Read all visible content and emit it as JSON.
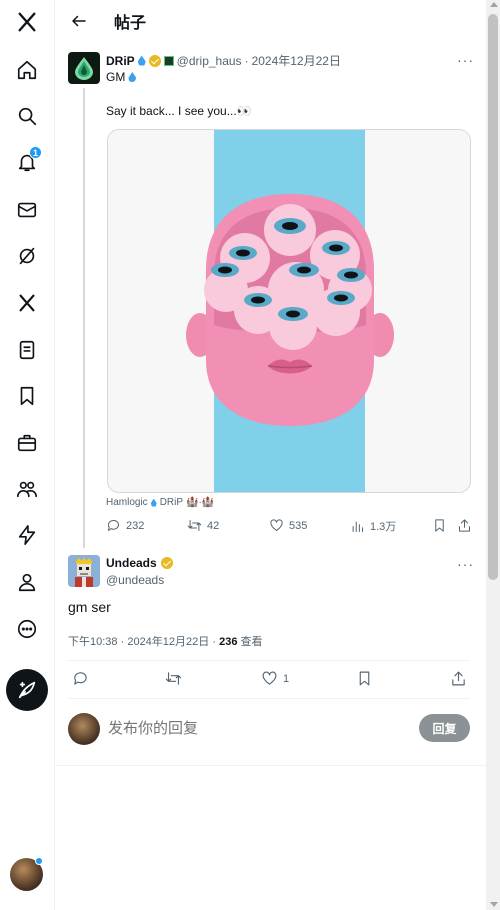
{
  "header": {
    "title": "帖子"
  },
  "sidebar": {
    "items": [
      {
        "icon": "x-logo-icon"
      },
      {
        "icon": "home-icon"
      },
      {
        "icon": "search-icon"
      },
      {
        "icon": "bell-icon",
        "badge": "1"
      },
      {
        "icon": "mail-icon"
      },
      {
        "icon": "grok-icon"
      },
      {
        "icon": "x-icon"
      },
      {
        "icon": "lists-icon"
      },
      {
        "icon": "bookmark-icon"
      },
      {
        "icon": "briefcase-icon"
      },
      {
        "icon": "communities-icon"
      },
      {
        "icon": "lightning-icon"
      },
      {
        "icon": "profile-icon"
      },
      {
        "icon": "more-icon"
      }
    ],
    "post_button_icon": "compose-icon"
  },
  "tweet1": {
    "name": "DRiP",
    "handle": "@drip_haus",
    "date": "2024年12月22日",
    "line1": "GM",
    "text": "Say it back... I see you...👀",
    "media_caption_left": "Hamlogic",
    "media_caption_right": "DRiP",
    "media_caption_tail": "🏰·🏰",
    "stats": {
      "replies": "232",
      "reposts": "42",
      "likes": "535",
      "views": "1.3万"
    }
  },
  "tweet2": {
    "name": "Undeads",
    "handle": "@undeads",
    "body": "gm ser",
    "time": "下午10:38",
    "date": "2024年12月22日",
    "views_count": "236",
    "views_label": "查看",
    "likes": "1"
  },
  "composer": {
    "placeholder": "发布你的回复",
    "button": "回复"
  },
  "colors": {
    "accent": "#1d9bf0",
    "text": "#0f1419",
    "muted": "#536471",
    "verified": "#e8b923"
  }
}
